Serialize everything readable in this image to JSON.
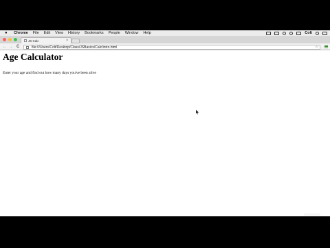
{
  "menubar": {
    "apple_icon": "apple-icon",
    "app_name": "Chrome",
    "items": [
      "File",
      "Edit",
      "View",
      "History",
      "Bookmarks",
      "People",
      "Window",
      "Help"
    ],
    "user": "Colt"
  },
  "tab": {
    "title": "JS Calc",
    "close_glyph": "×"
  },
  "toolbar": {
    "back_glyph": "←",
    "forward_glyph": "→",
    "reload_glyph": "C",
    "url": "file:///Users/Colt/Desktop/Class/JSBasics/Calc/intro.html",
    "star_glyph": "☆"
  },
  "page": {
    "heading": "Age Calculator",
    "instructions": "Enter your age and find out how many days you've been alive"
  },
  "colors": {
    "traffic_close": "#fc605c",
    "traffic_minimize": "#fdbc40",
    "traffic_zoom": "#34c84a",
    "menu_accent": "#3a8d2f"
  }
}
